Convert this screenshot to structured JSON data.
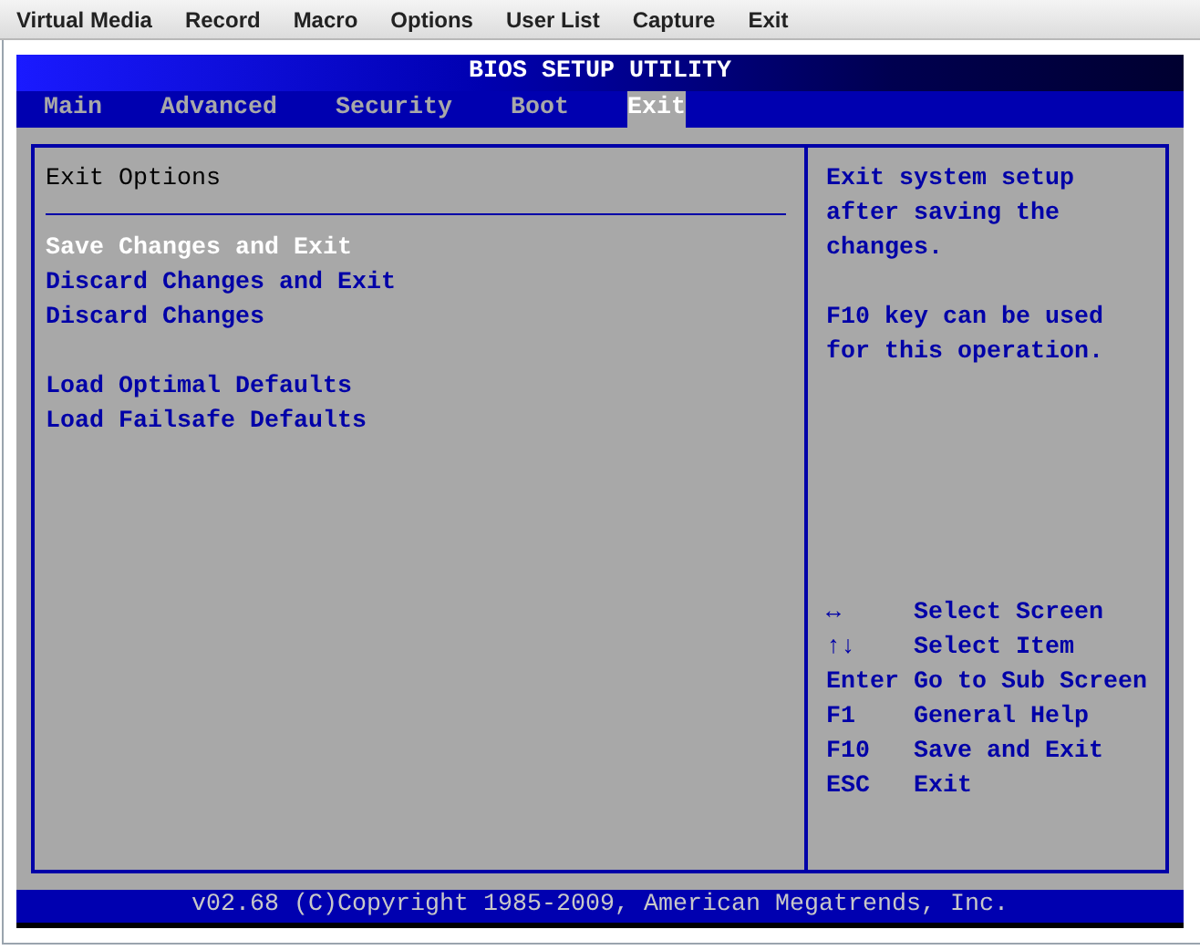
{
  "menu_bar": [
    "Virtual Media",
    "Record",
    "Macro",
    "Options",
    "User List",
    "Capture",
    "Exit"
  ],
  "bios": {
    "title": "BIOS SETUP UTILITY",
    "tabs": [
      {
        "label": "Main",
        "selected": false
      },
      {
        "label": "Advanced",
        "selected": false
      },
      {
        "label": "Security",
        "selected": false
      },
      {
        "label": "Boot",
        "selected": false
      },
      {
        "label": "Exit",
        "selected": true
      }
    ],
    "section_title": "Exit Options",
    "option_groups": [
      [
        {
          "label": "Save Changes and Exit",
          "selected": true
        },
        {
          "label": "Discard Changes and Exit",
          "selected": false
        },
        {
          "label": "Discard Changes",
          "selected": false
        }
      ],
      [
        {
          "label": "Load Optimal Defaults",
          "selected": false
        },
        {
          "label": "Load Failsafe Defaults",
          "selected": false
        }
      ]
    ],
    "help_text": [
      "Exit system setup after saving the changes.",
      "F10 key can be used for this operation."
    ],
    "key_legend": [
      {
        "key": "↔",
        "action": "Select Screen"
      },
      {
        "key": "↑↓",
        "action": "Select Item"
      },
      {
        "key": "Enter",
        "action": "Go to Sub Screen"
      },
      {
        "key": "F1",
        "action": "General Help"
      },
      {
        "key": "F10",
        "action": "Save and Exit"
      },
      {
        "key": "ESC",
        "action": "Exit"
      }
    ],
    "footer": "v02.68 (C)Copyright 1985-2009, American Megatrends, Inc."
  }
}
